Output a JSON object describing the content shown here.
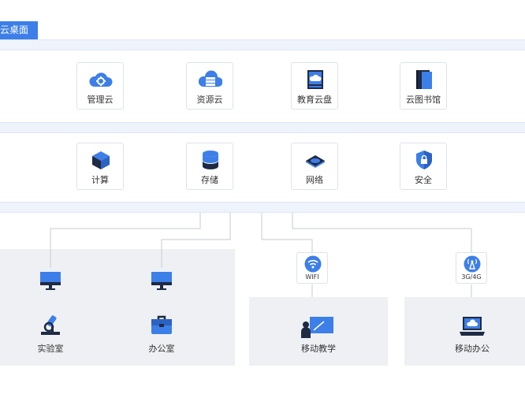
{
  "header": {
    "tag": "云桌面"
  },
  "colors": {
    "accent": "#3d7fe8",
    "dark": "#1f2a44"
  },
  "layer1": [
    {
      "label": "管理云",
      "icon": "cloud-gear-icon"
    },
    {
      "label": "资源云",
      "icon": "cloud-server-icon"
    },
    {
      "label": "教育云盘",
      "icon": "cloud-drive-icon"
    },
    {
      "label": "云图书馆",
      "icon": "cloud-book-icon"
    }
  ],
  "layer2": [
    {
      "label": "计算",
      "icon": "cube-icon"
    },
    {
      "label": "存储",
      "icon": "database-icon"
    },
    {
      "label": "网络",
      "icon": "network-icon"
    },
    {
      "label": "安全",
      "icon": "shield-lock-icon"
    }
  ],
  "connectors": [
    {
      "label": "WIFI",
      "icon": "wifi-icon"
    },
    {
      "label": "3G/4G",
      "icon": "antenna-icon"
    }
  ],
  "endpoints": [
    {
      "label": "实验室",
      "icon": "microscope-icon"
    },
    {
      "label": "办公室",
      "icon": "briefcase-icon"
    },
    {
      "label": "移动教学",
      "icon": "teacher-board-icon"
    },
    {
      "label": "移动办公",
      "icon": "laptop-cloud-icon"
    }
  ]
}
